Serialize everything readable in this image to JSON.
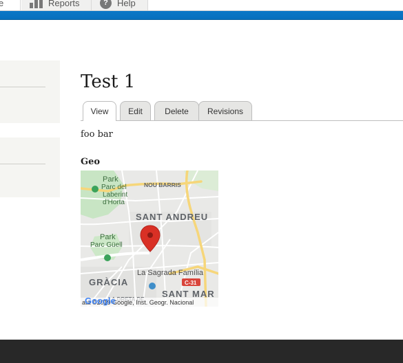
{
  "toolbar": {
    "cut_label": "e",
    "reports_label": "Reports",
    "help_label": "Help"
  },
  "colors": {
    "toolbar_blue": "#0b77c7",
    "sidebar_bg": "#f5f5f2",
    "footer_bg": "#282828",
    "map_pin": "#d93025"
  },
  "page": {
    "title": "Test 1",
    "body": "foo bar"
  },
  "tabs": [
    {
      "label": "View",
      "active": true
    },
    {
      "label": "Edit",
      "active": false
    },
    {
      "label": "Delete",
      "active": false
    },
    {
      "label": "Revisions",
      "active": false
    }
  ],
  "field": {
    "label": "Geo"
  },
  "map": {
    "labels": {
      "park_laberint_1": "Park",
      "park_laberint_2": "Parc del",
      "park_laberint_3": "Laberint",
      "park_laberint_4": "d'Horta",
      "nou_barris": "NOU BARRIS",
      "sant_andreu": "SANT ANDREU",
      "park_guell_1": "Park",
      "park_guell_2": "Parc Güell",
      "gracia": "GRÀCIA",
      "sagrada": "La Sagrada Família",
      "c31": "C-31",
      "sant_mar": "SANT MAR",
      "dreta": "LA DRETA DE",
      "attribution": "ata ©2019 Google, Inst. Geogr. Nacional",
      "google_logo": "Google"
    }
  }
}
